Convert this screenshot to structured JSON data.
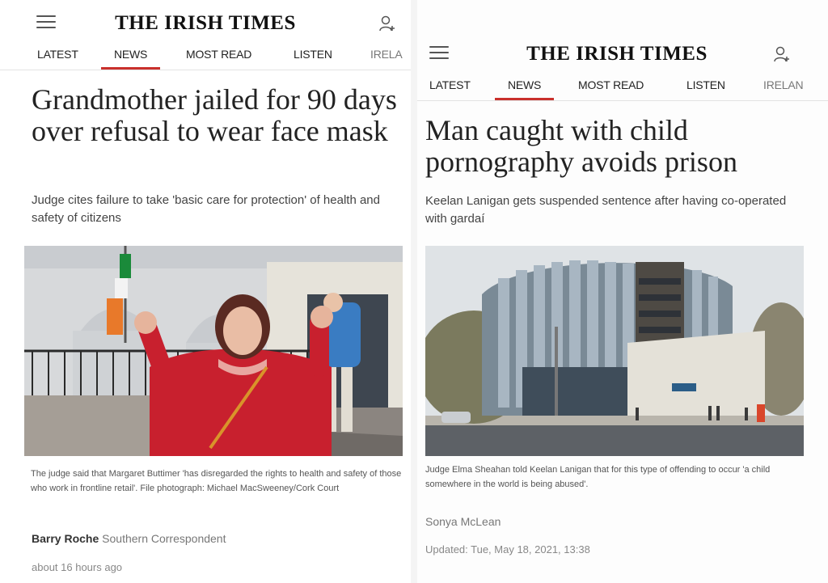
{
  "left": {
    "brand": "THE IRISH TIMES",
    "nav": [
      "LATEST",
      "NEWS",
      "MOST READ",
      "LISTEN",
      "IRELAND"
    ],
    "nav_active": "NEWS",
    "headline": "Grandmother jailed for 90 days over refusal to wear face mask",
    "standfirst": "Judge cites failure to take 'basic care for protection' of health and safety of citizens",
    "caption": "The judge said that Margaret Buttimer 'has disregarded the rights to health and safety of those who work in frontline retail'. File photograph: Michael MacSweeney/Cork Court",
    "author": "Barry Roche",
    "author_role": "Southern Correspondent",
    "time": "about 16 hours ago"
  },
  "right": {
    "brand": "THE IRISH TIMES",
    "nav": [
      "LATEST",
      "NEWS",
      "MOST READ",
      "LISTEN",
      "IRELAND"
    ],
    "nav_active": "NEWS",
    "headline": "Man caught with child pornography avoids prison",
    "standfirst": "Keelan Lanigan gets suspended sentence after having co-operated with gardaí",
    "caption": "Judge Elma Sheahan told Keelan Lanigan that for this type of offending to occur 'a child somewhere in the world is being abused'.",
    "photo_credit": "Sonya McLean",
    "updated": "Updated: Tue, May 18, 2021, 13:38"
  },
  "icons": {
    "menu": "hamburger-menu-icon",
    "account": "user-add-icon"
  },
  "colors": {
    "accent": "#c9302c",
    "brand_text": "#111111"
  }
}
